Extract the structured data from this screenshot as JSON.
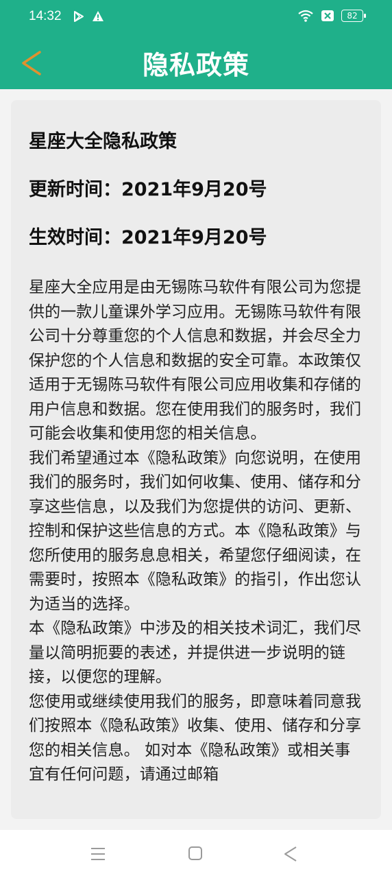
{
  "status_bar": {
    "time": "14:32",
    "battery": "82"
  },
  "app_bar": {
    "title": "隐私政策",
    "back_icon": "chevron-left-icon",
    "color": "#1fb08a",
    "back_color": "#e0912f"
  },
  "document": {
    "title": "星座大全隐私政策",
    "updated": "更新时间：2021年9月20号",
    "effective": "生效时间：2021年9月20号",
    "paragraphs": [
      "星座大全应用是由无锡陈马软件有限公司为您提供的一款儿童课外学习应用。无锡陈马软件有限公司十分尊重您的个人信息和数据，并会尽全力保护您的个人信息和数据的安全可靠。本政策仅适用于无锡陈马软件有限公司应用收集和存储的用户信息和数据。您在使用我们的服务时，我们可能会收集和使用您的相关信息。",
      "我们希望通过本《隐私政策》向您说明，在使用我们的服务时，我们如何收集、使用、储存和分享这些信息，以及我们为您提供的访问、更新、控制和保护这些信息的方式。本《隐私政策》与您所使用的服务息息相关，希望您仔细阅读，在需要时，按照本《隐私政策》的指引，作出您认为适当的选择。",
      "本《隐私政策》中涉及的相关技术词汇，我们尽量以简明扼要的表述，并提供进一步说明的链接，以便您的理解。",
      "您使用或继续使用我们的服务，即意味着同意我们按照本《隐私政策》收集、使用、储存和分享您的相关信息。 如对本《隐私政策》或相关事宜有任何问题，请通过邮箱"
    ]
  },
  "nav_bar": {
    "menu_icon": "menu-icon",
    "home_icon": "home-square-icon",
    "back_icon": "back-triangle-icon"
  }
}
